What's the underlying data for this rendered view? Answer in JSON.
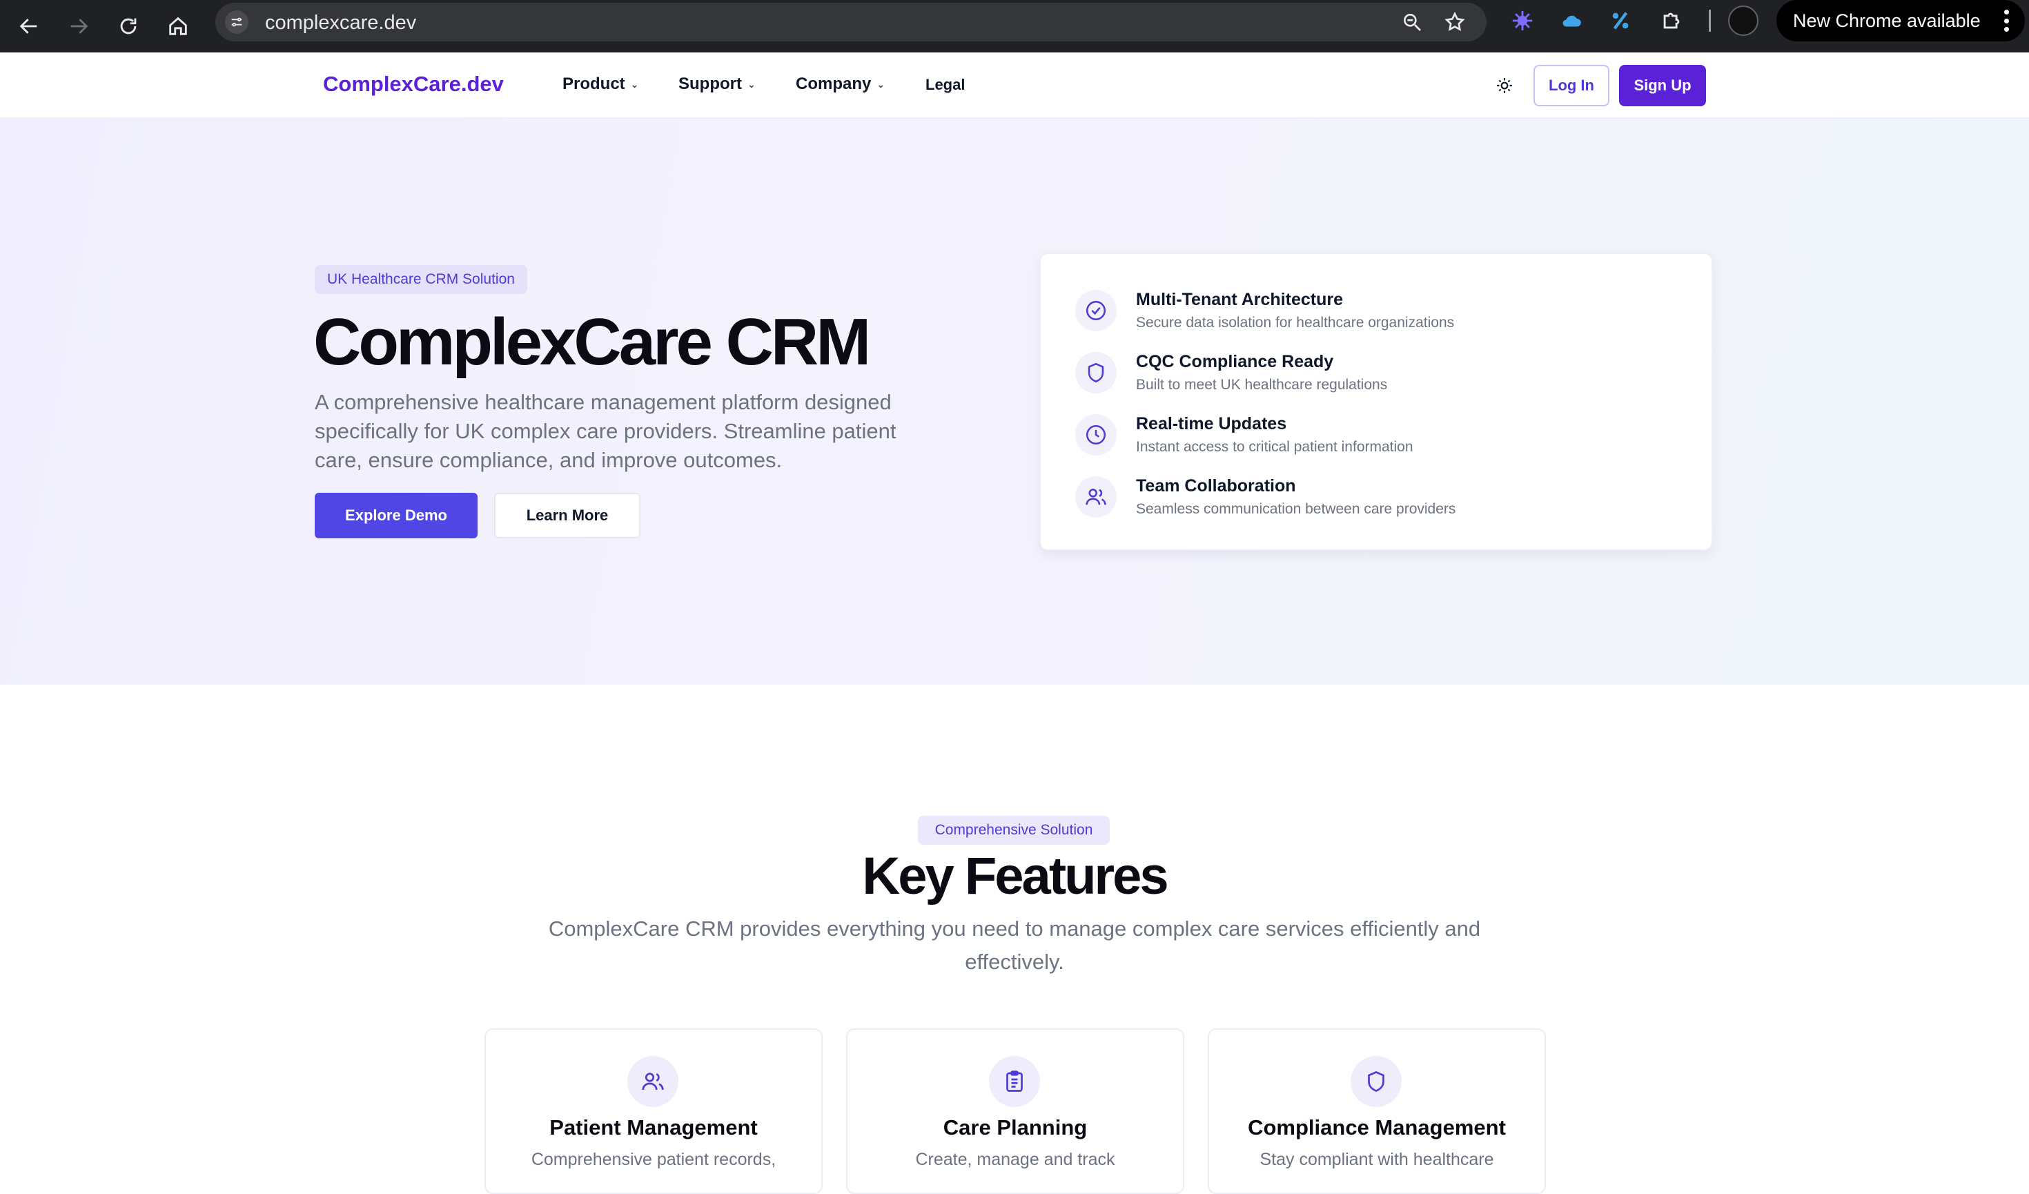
{
  "browser": {
    "url": "complexcare.dev",
    "update_label": "New Chrome available"
  },
  "header": {
    "brand": "ComplexCare.dev",
    "menu": [
      {
        "label": "Product"
      },
      {
        "label": "Support"
      },
      {
        "label": "Company"
      },
      {
        "label": "Legal"
      }
    ],
    "login_label": "Log In",
    "signup_label": "Sign Up"
  },
  "hero": {
    "badge": "UK Healthcare CRM Solution",
    "title": "ComplexCare CRM",
    "description": "A comprehensive healthcare management platform designed specifically for UK complex care providers. Streamline patient care, ensure compliance, and improve outcomes.",
    "primary_button": "Explore Demo",
    "secondary_button": "Learn More",
    "features": [
      {
        "icon": "check-circle-icon",
        "title": "Multi-Tenant Architecture",
        "subtitle": "Secure data isolation for healthcare organizations"
      },
      {
        "icon": "shield-icon",
        "title": "CQC Compliance Ready",
        "subtitle": "Built to meet UK healthcare regulations"
      },
      {
        "icon": "clock-icon",
        "title": "Real-time Updates",
        "subtitle": "Instant access to critical patient information"
      },
      {
        "icon": "users-icon",
        "title": "Team Collaboration",
        "subtitle": "Seamless communication between care providers"
      }
    ]
  },
  "key_features": {
    "badge": "Comprehensive Solution",
    "title": "Key Features",
    "description": "ComplexCare CRM provides everything you need to manage complex care services efficiently and effectively.",
    "cards": [
      {
        "icon": "users-icon",
        "title": "Patient Management",
        "subtitle": "Comprehensive patient records,"
      },
      {
        "icon": "clipboard-icon",
        "title": "Care Planning",
        "subtitle": "Create, manage and track"
      },
      {
        "icon": "shield-icon",
        "title": "Compliance Management",
        "subtitle": "Stay compliant with healthcare"
      }
    ]
  },
  "colors": {
    "brand": "#5b21d6",
    "primary_button": "#4f46e5",
    "accent_text": "#4c3bd4",
    "muted_text": "#6b7280"
  }
}
